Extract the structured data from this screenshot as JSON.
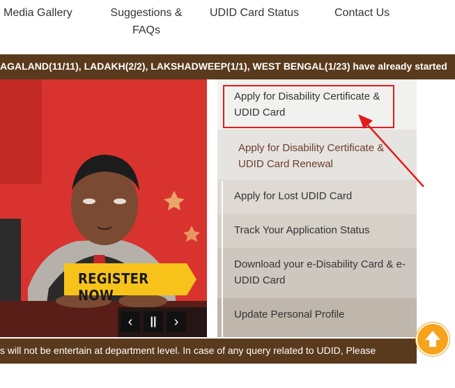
{
  "nav": {
    "media": "Media Gallery",
    "suggestions": "Suggestions &",
    "suggestions_line2": "FAQs",
    "udid_status": "UDID Card Status",
    "contact": "Contact Us"
  },
  "ticker": {
    "text": "AGALAND(11/11), LADAKH(2/2), LAKSHADWEEP(1/1), WEST BENGAL(1/23)  have already started"
  },
  "slider": {
    "register_label": "REGISTER NOW",
    "prev_icon": "‹",
    "pause_icon": "||",
    "next_icon": "›"
  },
  "menu": {
    "items": [
      {
        "label": "Apply for Disability Certificate & UDID Card"
      },
      {
        "label": "Apply for Disability Certificate & UDID Card Renewal"
      },
      {
        "label": "Apply for Lost UDID Card"
      },
      {
        "label": "Track Your Application Status"
      },
      {
        "label": "Download your e-Disability Card & e-UDID Card"
      },
      {
        "label": "Update Personal Profile"
      }
    ]
  },
  "bottom_ticker": {
    "text": "s will not be entertain at department level. In case of any query related to UDID, Please"
  },
  "colors": {
    "brown": "#5a3a1c",
    "highlight_red": "#e01c1c",
    "register_yellow": "#f7c31a",
    "scroll_top_orange": "#f7a21b"
  }
}
